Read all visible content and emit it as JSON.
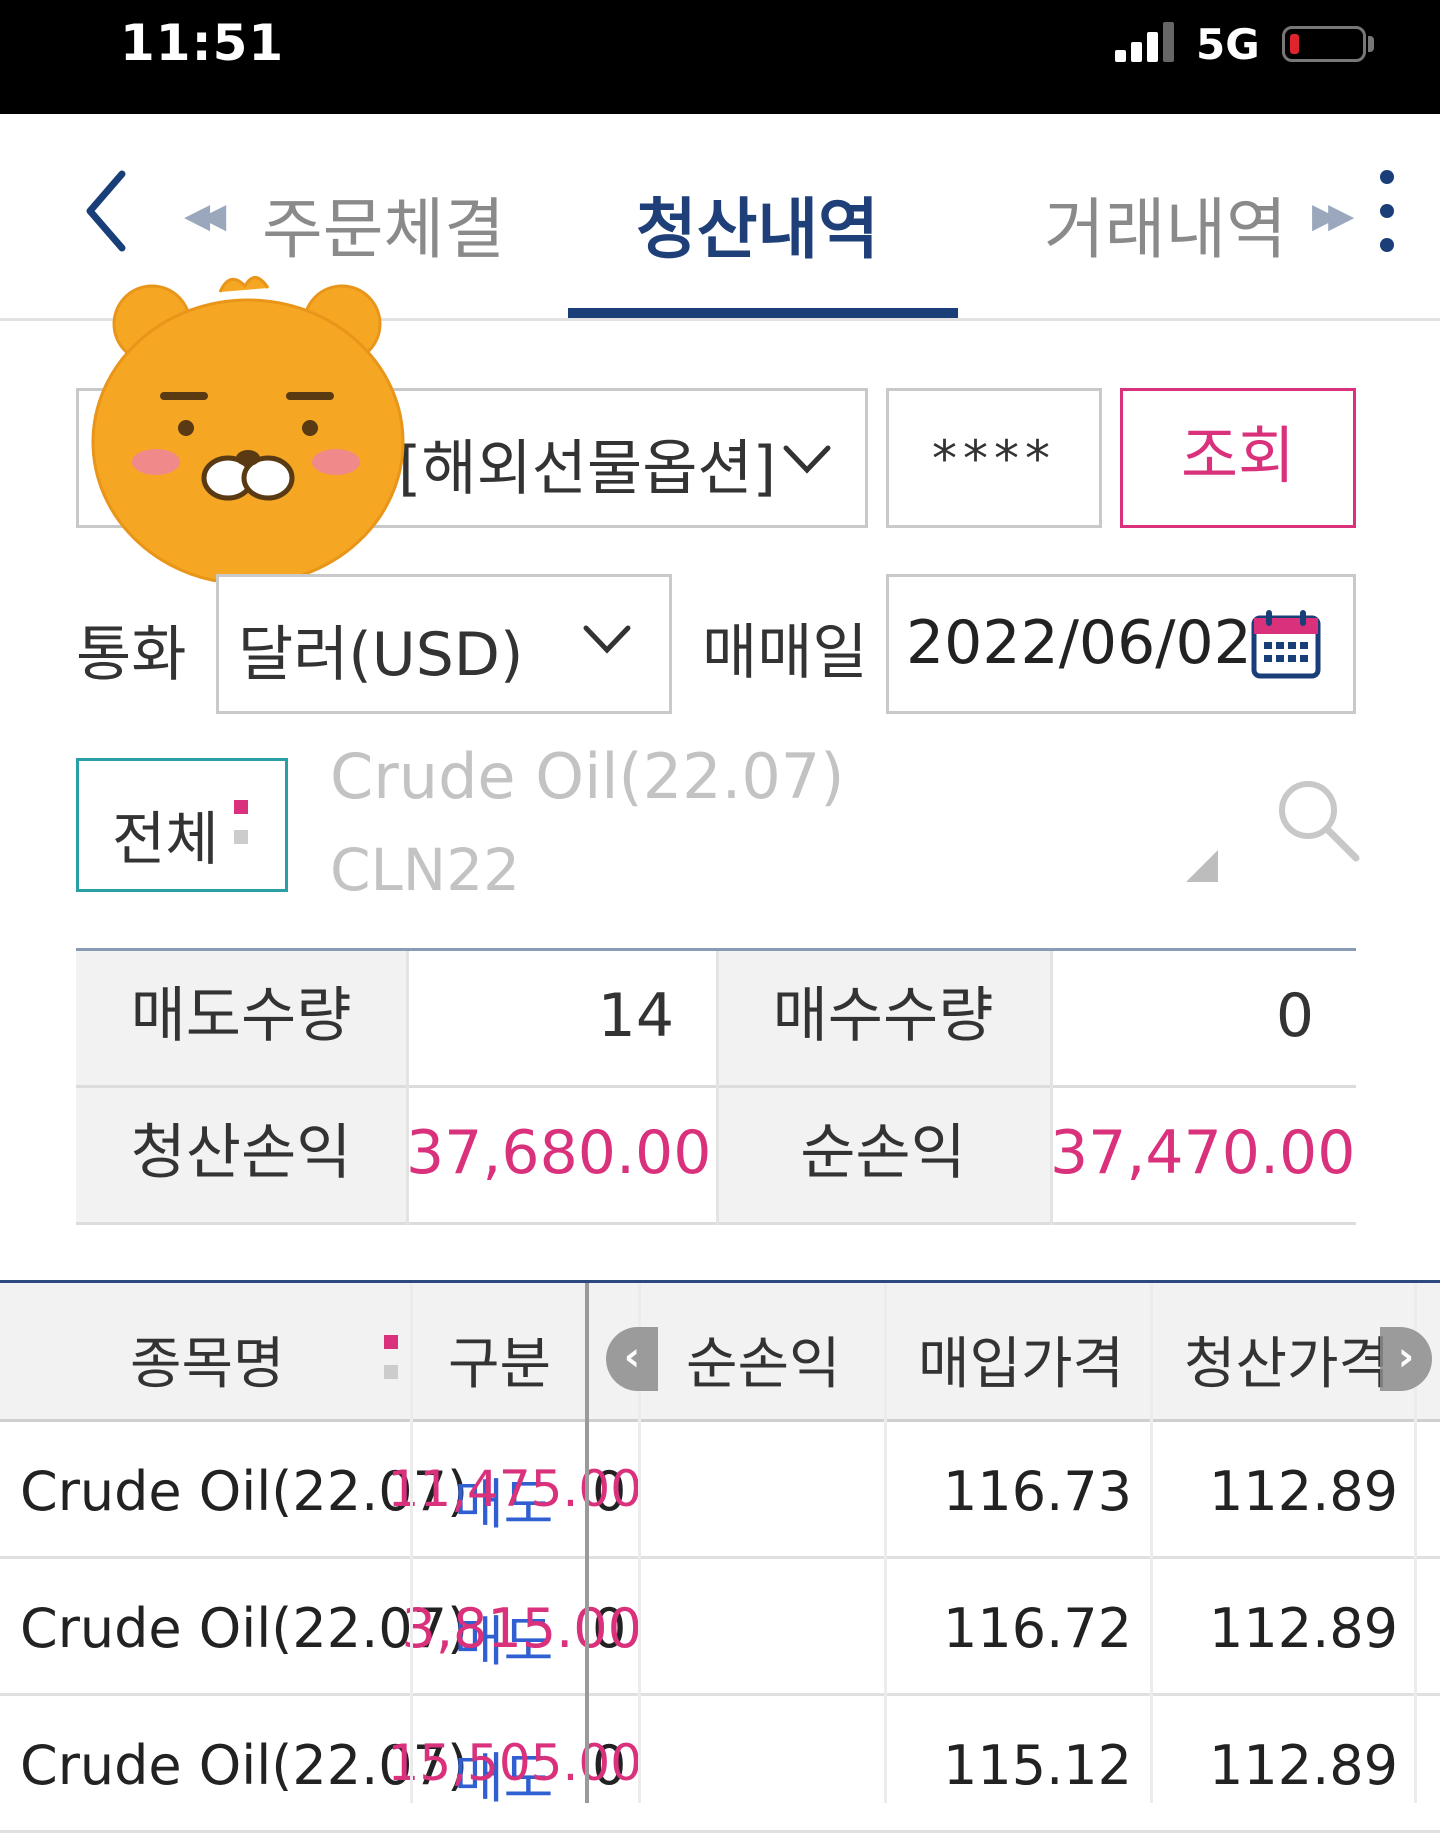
{
  "status_bar": {
    "time": "11:51",
    "network": "5G"
  },
  "tabs": {
    "prev": "주문체결",
    "active": "청산내역",
    "next": "거래내역"
  },
  "account": {
    "type": "[해외선물옵션]",
    "password": "****",
    "search_button": "조회"
  },
  "filters": {
    "currency_label": "통화",
    "currency_value": "달러(USD)",
    "date_label": "매매일",
    "date_value": "2022/06/02",
    "scope_button": "전체",
    "product_name": "Crude Oil(22.07)",
    "product_code": "CLN22"
  },
  "summary": {
    "sell_qty_label": "매도수량",
    "sell_qty": "14",
    "buy_qty_label": "매수수량",
    "buy_qty": "0",
    "settle_pl_label": "청산손익",
    "settle_pl": "37,680.00",
    "net_pl_label": "순손익",
    "net_pl": "37,470.00"
  },
  "table": {
    "headers": {
      "name": "종목명",
      "type": "구분",
      "net": "순손익",
      "buy_price": "매입가격",
      "clear_price": "청산가격"
    },
    "rows": [
      {
        "name": "Crude Oil(22.07)",
        "type": "매도",
        "cut": "0",
        "net": "11,475.00",
        "buy_price": "116.73",
        "clear_price": "112.89"
      },
      {
        "name": "Crude Oil(22.07)",
        "type": "매도",
        "cut": "0",
        "net": "3,815.00",
        "buy_price": "116.72",
        "clear_price": "112.89"
      },
      {
        "name": "Crude Oil(22.07)",
        "type": "매도",
        "cut": "0",
        "net": "15,505.00",
        "buy_price": "115.12",
        "clear_price": "112.89"
      }
    ]
  },
  "colors": {
    "accent": "#1a3e78",
    "pink": "#d9317b",
    "teal": "#2aa0a6",
    "blue": "#2f5fd0"
  },
  "icons": [
    "back-chevron-icon",
    "double-left-arrow-icon",
    "double-right-arrow-icon",
    "more-vertical-icon",
    "chevron-down-icon",
    "calendar-icon",
    "search-icon",
    "mascot-sticker",
    "scroll-left-icon",
    "scroll-right-icon"
  ]
}
